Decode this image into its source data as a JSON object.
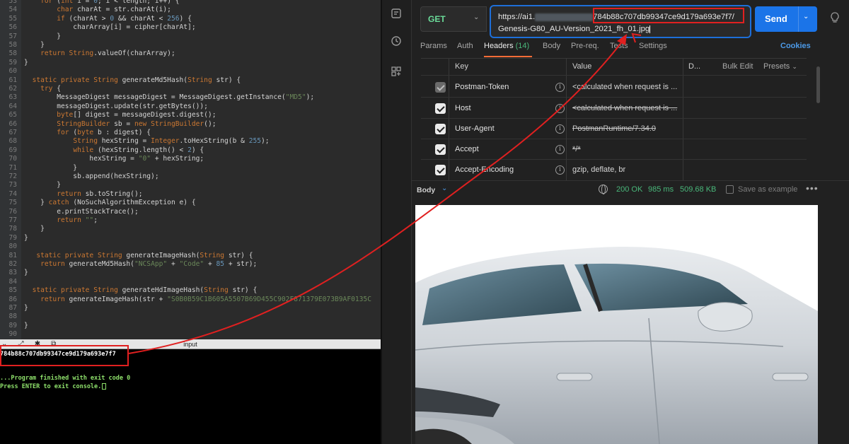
{
  "editor": {
    "lines": [
      {
        "n": "53",
        "segments": [
          {
            "t": "    "
          },
          {
            "t": "for",
            "c": "kw"
          },
          {
            "t": " ("
          },
          {
            "t": "int",
            "c": "kw"
          },
          {
            "t": " i = "
          },
          {
            "t": "0",
            "c": "num"
          },
          {
            "t": "; i < length; i++) {"
          }
        ]
      },
      {
        "n": "54",
        "segments": [
          {
            "t": "        "
          },
          {
            "t": "char",
            "c": "kw"
          },
          {
            "t": " charAt = str.charAt(i);"
          }
        ]
      },
      {
        "n": "55",
        "segments": [
          {
            "t": "        "
          },
          {
            "t": "if",
            "c": "kw"
          },
          {
            "t": " (charAt > "
          },
          {
            "t": "0",
            "c": "num"
          },
          {
            "t": " && charAt < "
          },
          {
            "t": "256",
            "c": "num"
          },
          {
            "t": ") {"
          }
        ]
      },
      {
        "n": "56",
        "segments": [
          {
            "t": "            charArray[i] = cipher[charAt];"
          }
        ]
      },
      {
        "n": "57",
        "segments": [
          {
            "t": "        }"
          }
        ]
      },
      {
        "n": "58",
        "segments": [
          {
            "t": "    }"
          }
        ]
      },
      {
        "n": "58",
        "segments": [
          {
            "t": "    "
          },
          {
            "t": "return",
            "c": "kw"
          },
          {
            "t": " "
          },
          {
            "t": "String",
            "c": "kw"
          },
          {
            "t": ".valueOf(charArray);"
          }
        ]
      },
      {
        "n": "59",
        "segments": [
          {
            "t": "}"
          }
        ]
      },
      {
        "n": "60",
        "segments": [
          {
            "t": ""
          }
        ]
      },
      {
        "n": "61",
        "segments": [
          {
            "t": "  "
          },
          {
            "t": "static private",
            "c": "kw"
          },
          {
            "t": " "
          },
          {
            "t": "String",
            "c": "kw"
          },
          {
            "t": " generateMd5Hash("
          },
          {
            "t": "String",
            "c": "kw"
          },
          {
            "t": " str) {"
          }
        ]
      },
      {
        "n": "62",
        "segments": [
          {
            "t": "    "
          },
          {
            "t": "try",
            "c": "kw"
          },
          {
            "t": " {"
          }
        ]
      },
      {
        "n": "63",
        "segments": [
          {
            "t": "        MessageDigest messageDigest = MessageDigest.getInstance("
          },
          {
            "t": "\"MD5\"",
            "c": "str"
          },
          {
            "t": ");"
          }
        ]
      },
      {
        "n": "64",
        "segments": [
          {
            "t": "        messageDigest.update(str.getBytes());"
          }
        ]
      },
      {
        "n": "65",
        "segments": [
          {
            "t": "        "
          },
          {
            "t": "byte",
            "c": "kw"
          },
          {
            "t": "[] digest = messageDigest.digest();"
          }
        ]
      },
      {
        "n": "66",
        "segments": [
          {
            "t": "        "
          },
          {
            "t": "StringBuilder",
            "c": "kw"
          },
          {
            "t": " sb = "
          },
          {
            "t": "new",
            "c": "kw"
          },
          {
            "t": " "
          },
          {
            "t": "StringBuilder",
            "c": "kw"
          },
          {
            "t": "();"
          }
        ]
      },
      {
        "n": "67",
        "segments": [
          {
            "t": "        "
          },
          {
            "t": "for",
            "c": "kw"
          },
          {
            "t": " ("
          },
          {
            "t": "byte",
            "c": "kw"
          },
          {
            "t": " b : digest) {"
          }
        ]
      },
      {
        "n": "68",
        "segments": [
          {
            "t": "            "
          },
          {
            "t": "String",
            "c": "kw"
          },
          {
            "t": " hexString = "
          },
          {
            "t": "Integer",
            "c": "kw"
          },
          {
            "t": ".toHexString(b & "
          },
          {
            "t": "255",
            "c": "num"
          },
          {
            "t": ");"
          }
        ]
      },
      {
        "n": "69",
        "segments": [
          {
            "t": "            "
          },
          {
            "t": "while",
            "c": "kw"
          },
          {
            "t": " (hexString.length() < "
          },
          {
            "t": "2",
            "c": "num"
          },
          {
            "t": ") {"
          }
        ]
      },
      {
        "n": "70",
        "segments": [
          {
            "t": "                hexString = "
          },
          {
            "t": "\"0\"",
            "c": "str"
          },
          {
            "t": " + hexString;"
          }
        ]
      },
      {
        "n": "71",
        "segments": [
          {
            "t": "            }"
          }
        ]
      },
      {
        "n": "72",
        "segments": [
          {
            "t": "            sb.append(hexString);"
          }
        ]
      },
      {
        "n": "73",
        "segments": [
          {
            "t": "        }"
          }
        ]
      },
      {
        "n": "74",
        "segments": [
          {
            "t": "        "
          },
          {
            "t": "return",
            "c": "kw"
          },
          {
            "t": " sb.toString();"
          }
        ]
      },
      {
        "n": "75",
        "segments": [
          {
            "t": "    } "
          },
          {
            "t": "catch",
            "c": "kw"
          },
          {
            "t": " (NoSuchAlgorithmException e) {"
          }
        ]
      },
      {
        "n": "76",
        "segments": [
          {
            "t": "        e.printStackTrace();"
          }
        ]
      },
      {
        "n": "77",
        "segments": [
          {
            "t": "        "
          },
          {
            "t": "return",
            "c": "kw"
          },
          {
            "t": " "
          },
          {
            "t": "\"\"",
            "c": "str"
          },
          {
            "t": ";"
          }
        ]
      },
      {
        "n": "78",
        "segments": [
          {
            "t": "    }"
          }
        ]
      },
      {
        "n": "79",
        "segments": [
          {
            "t": "}"
          }
        ]
      },
      {
        "n": "80",
        "segments": [
          {
            "t": ""
          }
        ]
      },
      {
        "n": "81",
        "segments": [
          {
            "t": "   "
          },
          {
            "t": "static private",
            "c": "kw"
          },
          {
            "t": " "
          },
          {
            "t": "String",
            "c": "kw"
          },
          {
            "t": " generateImageHash("
          },
          {
            "t": "String",
            "c": "kw"
          },
          {
            "t": " str) {"
          }
        ]
      },
      {
        "n": "82",
        "segments": [
          {
            "t": "    "
          },
          {
            "t": "return",
            "c": "kw"
          },
          {
            "t": " generateMd5Hash("
          },
          {
            "t": "\"NCSApp\"",
            "c": "str"
          },
          {
            "t": " + "
          },
          {
            "t": "\"Code\"",
            "c": "str"
          },
          {
            "t": " + "
          },
          {
            "t": "85",
            "c": "num"
          },
          {
            "t": " + str);"
          }
        ]
      },
      {
        "n": "83",
        "segments": [
          {
            "t": "}"
          }
        ]
      },
      {
        "n": "84",
        "segments": [
          {
            "t": ""
          }
        ]
      },
      {
        "n": "85",
        "segments": [
          {
            "t": "  "
          },
          {
            "t": "static private",
            "c": "kw"
          },
          {
            "t": " "
          },
          {
            "t": "String",
            "c": "kw"
          },
          {
            "t": " generateHdImageHash("
          },
          {
            "t": "String",
            "c": "kw"
          },
          {
            "t": " str) {"
          }
        ]
      },
      {
        "n": "86",
        "segments": [
          {
            "t": "    "
          },
          {
            "t": "return",
            "c": "kw"
          },
          {
            "t": " generateImageHash(str + "
          },
          {
            "t": "\"S0B0B59C1B605A5507B69D455C902F871379E073B9AF0135C",
            "c": "str"
          }
        ]
      },
      {
        "n": "87",
        "segments": [
          {
            "t": "}"
          }
        ]
      },
      {
        "n": "88",
        "segments": [
          {
            "t": ""
          }
        ]
      },
      {
        "n": "89",
        "segments": [
          {
            "t": "}"
          }
        ]
      },
      {
        "n": "90",
        "segments": [
          {
            "t": ""
          }
        ]
      }
    ]
  },
  "console": {
    "tools": "⌄ ⤢ ✱ ⧉",
    "title": "input",
    "hash_output": "784b88c707db99347ce9d179a693e7f7",
    "finished": "...Program finished with exit code 0",
    "enter_prompt": "Press ENTER to exit console."
  },
  "postman": {
    "rail_icons": [
      "new-request-icon",
      "history-icon",
      "apps-icon"
    ],
    "method": "GET",
    "url": {
      "prefix": "https://ai1.",
      "hash": "784b88c707db99347ce9d179a693e7f7/",
      "line2": "Genesis-G80_AU-Version_2021_fh_01.jpg"
    },
    "send_label": "Send",
    "tabs": [
      {
        "label": "Params"
      },
      {
        "label": "Auth"
      },
      {
        "label": "Headers",
        "count": "(14)"
      },
      {
        "label": "Body"
      },
      {
        "label": "Pre-req."
      },
      {
        "label": "Tests"
      },
      {
        "label": "Settings"
      }
    ],
    "cookies_label": "Cookies",
    "table": {
      "col_key": "Key",
      "col_value": "Value",
      "col_desc": "D...",
      "bulk_edit": "Bulk Edit",
      "presets": "Presets",
      "rows": [
        {
          "key": "Postman-Token",
          "value": "<calculated when request is ...",
          "strike": false,
          "dim": true
        },
        {
          "key": "Host",
          "value": "<calculated when request is ...",
          "strike": true,
          "dim": false
        },
        {
          "key": "User-Agent",
          "value": "PostmanRuntime/7.34.0",
          "strike": true,
          "dim": false
        },
        {
          "key": "Accept",
          "value": "*/*",
          "strike": true,
          "dim": false
        },
        {
          "key": "Accept-Encoding",
          "value": "gzip, deflate, br",
          "strike": false,
          "dim": false
        }
      ]
    },
    "response": {
      "body_label": "Body",
      "status": "200 OK",
      "time": "985 ms",
      "size": "509.68 KB",
      "save_example": "Save as example"
    },
    "colors": {
      "send": "#1b74e8",
      "method_get": "#6bdd9a",
      "highlight_box": "#e02020",
      "url_box": "#1e6fd9",
      "active_tab_underline": "#ff6c37",
      "status_ok": "#49b77a"
    }
  }
}
